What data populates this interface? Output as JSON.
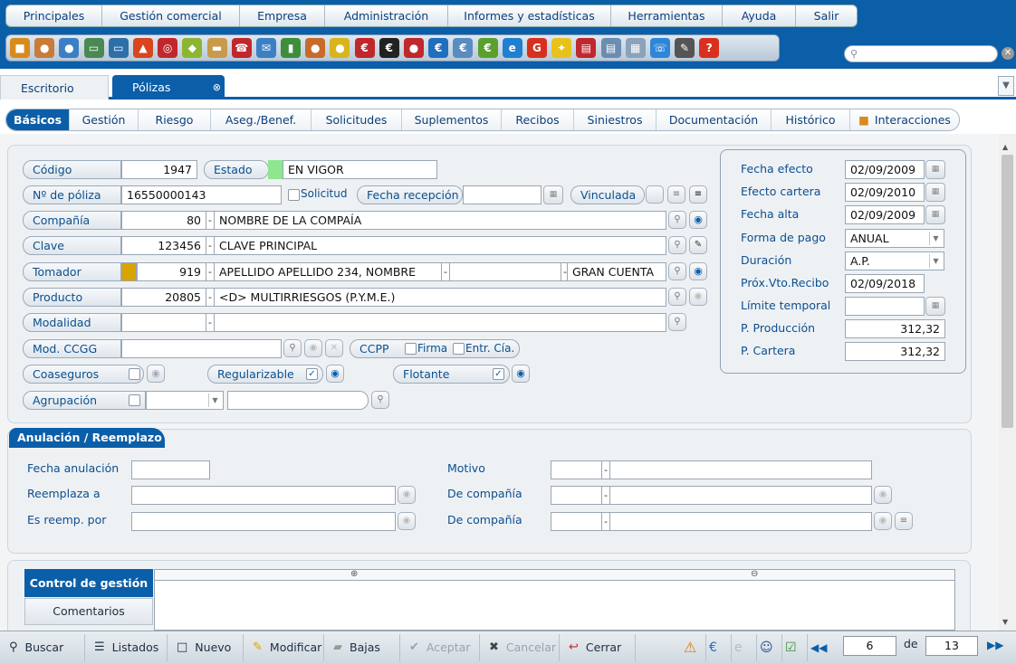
{
  "menu": [
    "Principales",
    "Gestión comercial",
    "Empresa",
    "Administración",
    "Informes y estadísticas",
    "Herramientas",
    "Ayuda",
    "Salir"
  ],
  "toolbar_icons": [
    {
      "name": "cube-icon",
      "color": "#d98a1c",
      "glyph": "■"
    },
    {
      "name": "person-icon",
      "color": "#c97b3a",
      "glyph": "●"
    },
    {
      "name": "user-blue-icon",
      "color": "#3d7fc4",
      "glyph": "●"
    },
    {
      "name": "window-icon",
      "color": "#4a8a52",
      "glyph": "▭"
    },
    {
      "name": "window2-icon",
      "color": "#2e6fa8",
      "glyph": "▭"
    },
    {
      "name": "fire-icon",
      "color": "#d8451f",
      "glyph": "▲"
    },
    {
      "name": "target-icon",
      "color": "#c0282d",
      "glyph": "◎"
    },
    {
      "name": "ticket-icon",
      "color": "#8cb531",
      "glyph": "◆"
    },
    {
      "name": "folder-icon",
      "color": "#c89a4a",
      "glyph": "▬"
    },
    {
      "name": "phone-icon",
      "color": "#c0282d",
      "glyph": "☎"
    },
    {
      "name": "mail-icon",
      "color": "#3d7fc4",
      "glyph": "✉"
    },
    {
      "name": "building-icon",
      "color": "#3d8d3d",
      "glyph": "▮"
    },
    {
      "name": "agent-icon",
      "color": "#c86a2a",
      "glyph": "●"
    },
    {
      "name": "lightbulb-person-icon",
      "color": "#d9b41c",
      "glyph": "●"
    },
    {
      "name": "currency-red-icon",
      "color": "#c0282d",
      "glyph": "€"
    },
    {
      "name": "currency-black-icon",
      "color": "#222222",
      "glyph": "€"
    },
    {
      "name": "users-red-icon",
      "color": "#c0282d",
      "glyph": "●"
    },
    {
      "name": "euro-blue-icon",
      "color": "#1f6fc0",
      "glyph": "€"
    },
    {
      "name": "cloud-euro-icon",
      "color": "#5b8cc0",
      "glyph": "€"
    },
    {
      "name": "euro-green-icon",
      "color": "#5aa02c",
      "glyph": "€"
    },
    {
      "name": "ie-icon",
      "color": "#1f7fd0",
      "glyph": "e"
    },
    {
      "name": "google-icon",
      "color": "#d8301f",
      "glyph": "G"
    },
    {
      "name": "bulb-icon",
      "color": "#e8c21c",
      "glyph": "✦"
    },
    {
      "name": "document-red-icon",
      "color": "#c0282d",
      "glyph": "▤"
    },
    {
      "name": "notes-icon",
      "color": "#6b8db0",
      "glyph": "▤"
    },
    {
      "name": "certificate-icon",
      "color": "#8aa2ba",
      "glyph": "▦"
    },
    {
      "name": "phone-handset-icon",
      "color": "#2e86d8",
      "glyph": "☏"
    },
    {
      "name": "plug-icon",
      "color": "#555555",
      "glyph": "✎"
    },
    {
      "name": "help-icon",
      "color": "#d8301f",
      "glyph": "?"
    }
  ],
  "tabs": {
    "escritorio": "Escritorio",
    "polizas": "Pólizas"
  },
  "subtabs": [
    "Básicos",
    "Gestión",
    "Riesgo",
    "Aseg./Benef.",
    "Solicitudes",
    "Suplementos",
    "Recibos",
    "Siniestros",
    "Documentación",
    "Histórico",
    "Interacciones"
  ],
  "basicos": {
    "codigo_label": "Código",
    "codigo": "1947",
    "estado_label": "Estado",
    "estado": "EN VIGOR",
    "estado_color": "#8ee68e",
    "poliza_label": "Nº de póliza",
    "poliza": "16550000143",
    "solicitud_label": "Solicitud",
    "fecha_recepcion_label": "Fecha recepción",
    "fecha_recepcion": "",
    "vinculada_label": "Vinculada",
    "compania_label": "Compañía",
    "compania_code": "80",
    "compania_name": "NOMBRE DE LA COMPAÍA",
    "clave_label": "Clave",
    "clave_code": "123456",
    "clave_name": "CLAVE PRINCIPAL",
    "tomador_label": "Tomador",
    "tomador_code": "919",
    "tomador_name": "APELLIDO APELLIDO 234, NOMBRE",
    "tomador_extra": "",
    "tomador_group": "GRAN CUENTA",
    "tomador_color": "#d9a300",
    "producto_label": "Producto",
    "producto_code": "20805",
    "producto_name": "<D> MULTIRRIESGOS (P.Y.M.E.)",
    "modalidad_label": "Modalidad",
    "modalidad_code": "",
    "modalidad_name": "",
    "modccgg_label": "Mod. CCGG",
    "modccgg": "",
    "ccpp_label": "CCPP",
    "firma_label": "Firma",
    "entr_label": "Entr. Cía.",
    "coaseguros_label": "Coaseguros",
    "regularizable_label": "Regularizable",
    "flotante_label": "Flotante",
    "agrupacion_label": "Agrupación"
  },
  "fechas": {
    "fecha_efecto_label": "Fecha efecto",
    "fecha_efecto": "02/09/2009",
    "efecto_cartera_label": "Efecto cartera",
    "efecto_cartera": "02/09/2010",
    "fecha_alta_label": "Fecha alta",
    "fecha_alta": "02/09/2009",
    "forma_pago_label": "Forma de pago",
    "forma_pago": "ANUAL",
    "duracion_label": "Duración",
    "duracion": "A.P.",
    "prox_vto_label": "Próx.Vto.Recibo",
    "prox_vto": "02/09/2018",
    "limite_label": "Límite temporal",
    "limite": "",
    "p_produccion_label": "P. Producción",
    "p_produccion": "312,32",
    "p_cartera_label": "P. Cartera",
    "p_cartera": "312,32"
  },
  "anulacion": {
    "title": "Anulación / Reemplazo",
    "fecha_anulacion_label": "Fecha anulación",
    "reemplaza_label": "Reemplaza a",
    "es_reemp_label": "Es reemp. por",
    "motivo_label": "Motivo",
    "de_compania_label": "De compañía"
  },
  "control": {
    "control_gestion": "Control de gestión",
    "comentarios": "Comentarios"
  },
  "bottom": {
    "buscar": "Buscar",
    "listados": "Listados",
    "nuevo": "Nuevo",
    "modificar": "Modificar",
    "bajas": "Bajas",
    "aceptar": "Aceptar",
    "cancelar": "Cancelar",
    "cerrar": "Cerrar",
    "page": "6",
    "de": "de",
    "total": "13"
  }
}
